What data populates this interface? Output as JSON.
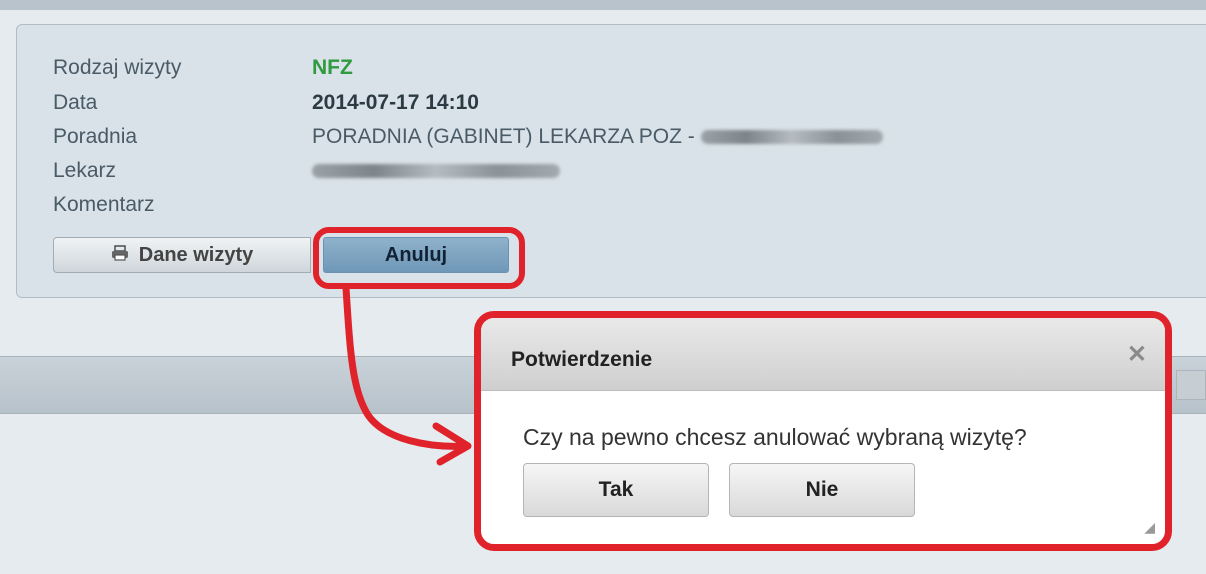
{
  "details": {
    "rows": [
      {
        "label": "Rodzaj wizyty",
        "value": "NFZ"
      },
      {
        "label": "Data",
        "value": "2014-07-17 14:10"
      },
      {
        "label": "Poradnia",
        "value": "PORADNIA (GABINET) LEKARZA POZ - "
      },
      {
        "label": "Lekarz",
        "value": ""
      },
      {
        "label": "Komentarz",
        "value": ""
      }
    ],
    "colors": {
      "nfz": "#2f9a3f",
      "highlight": "#e0222a"
    }
  },
  "buttons": {
    "dane_wizyty": "Dane wizyty",
    "anuluj": "Anuluj"
  },
  "dialog": {
    "title": "Potwierdzenie",
    "close_icon": "close-icon",
    "message": "Czy na pewno chcesz anulować wybraną wizytę?",
    "yes": "Tak",
    "no": "Nie"
  },
  "icons": {
    "print": "print-icon",
    "resize": "resize-grip-icon"
  }
}
